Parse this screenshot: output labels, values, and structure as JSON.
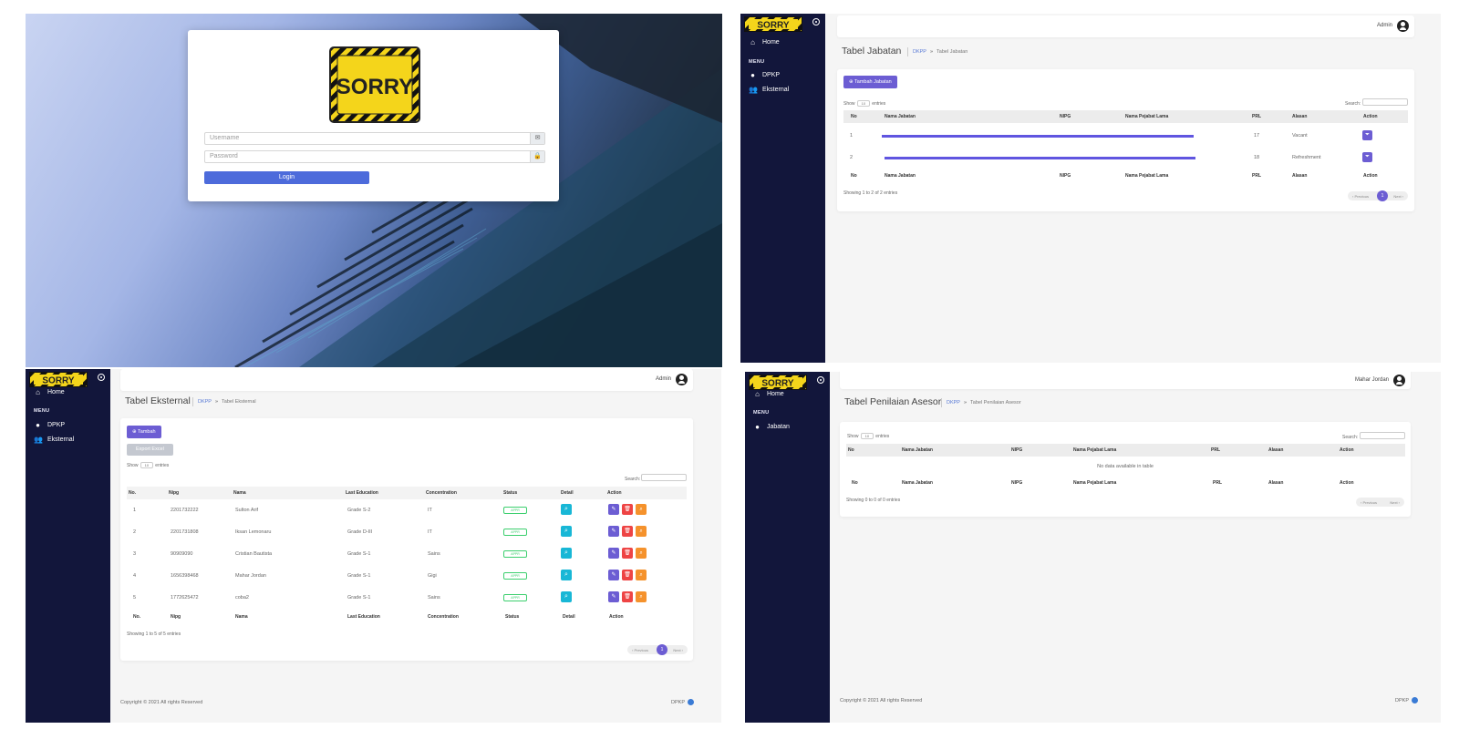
{
  "login": {
    "username_placeholder": "Username",
    "password_placeholder": "Password",
    "login_label": "Login",
    "user_icon": "envelope-icon",
    "lock_icon": "lock-icon"
  },
  "logo": {
    "text": "SORRY"
  },
  "sidebar": {
    "home": "Home",
    "menu_heading": "MENU",
    "dpkp": "DPKP",
    "eksternal": "Eksternal",
    "jabatan": "Jabatan"
  },
  "jabatan": {
    "user": "Admin",
    "title": "Tabel Jabatan",
    "crumb_link": "DKPP",
    "crumb_current": "Tabel Jabatan",
    "add_button": "Tambah Jabatan",
    "show": "Show",
    "entries": "entries",
    "page_size": "10",
    "search_label": "Search:",
    "columns": [
      "No",
      "Nama Jabatan",
      "NIPG",
      "Nama Pejabat Lama",
      "PRL",
      "Alasan",
      "Action"
    ],
    "rows": [
      {
        "no": "1",
        "prl": "17",
        "alasan": "Vacant"
      },
      {
        "no": "2",
        "prl": "18",
        "alasan": "Refreshment"
      }
    ],
    "info": "Showing 1 to 2 of 2 entries",
    "prev": "‹ Previous",
    "next": "Next ›",
    "page": "1"
  },
  "eksternal": {
    "user": "Admin",
    "title": "Tabel Eksternal",
    "crumb_link": "DKPP",
    "crumb_current": "Tabel Eksternal",
    "add_button": "Tambah",
    "export_button": "Export Excel",
    "show": "Show",
    "entries": "entries",
    "page_size": "10",
    "search_label": "Search:",
    "columns": [
      "No.",
      "Nipg",
      "Nama",
      "Last Education",
      "Concentration",
      "Status",
      "Detail",
      "Action"
    ],
    "rows": [
      {
        "no": "1",
        "nipg": "2201732222",
        "nama": "Sulton Arif",
        "edu": "Grade S-2",
        "conc": "IT",
        "status": "APPR"
      },
      {
        "no": "2",
        "nipg": "2201731808",
        "nama": "Iksan Lemonaru",
        "edu": "Grade D-III",
        "conc": "IT",
        "status": "APPR"
      },
      {
        "no": "3",
        "nipg": "90909090",
        "nama": "Cristian Bautista",
        "edu": "Grade S-1",
        "conc": "Sains",
        "status": "APPR"
      },
      {
        "no": "4",
        "nipg": "1656398468",
        "nama": "Mahar Jordan",
        "edu": "Grade S-1",
        "conc": "Gigi",
        "status": "APPR"
      },
      {
        "no": "5",
        "nipg": "1772625472",
        "nama": "coba2",
        "edu": "Grade S-1",
        "conc": "Sains",
        "status": "APPR"
      }
    ],
    "info": "Showing 1 to 5 of 5 entries",
    "prev": "‹ Previous",
    "next": "Next ›",
    "page": "1",
    "copyright": "Copyright © 2021 All rights Reserved",
    "brand": "DPKP"
  },
  "asesor": {
    "user": "Mahar Jordan",
    "title": "Tabel Penilaian Asesor",
    "crumb_link": "DKPP",
    "crumb_current": "Tabel Penilaian Asesor",
    "show": "Show",
    "entries": "entries",
    "page_size": "10",
    "search_label": "Search:",
    "columns": [
      "No",
      "Nama Jabatan",
      "NIPG",
      "Nama Pejabat Lama",
      "PRL",
      "Alasan",
      "Action"
    ],
    "empty": "No data available in table",
    "info": "Showing 0 to 0 of 0 entries",
    "prev": "‹ Previous",
    "next": "Next ›",
    "copyright": "Copyright © 2021 All rights Reserved",
    "brand": "DPKP"
  },
  "colors": {
    "sidebar": "#12163b",
    "primary": "#6c5dd3",
    "login_button": "#4d6bdb",
    "logo_yellow": "#f4d51b"
  }
}
